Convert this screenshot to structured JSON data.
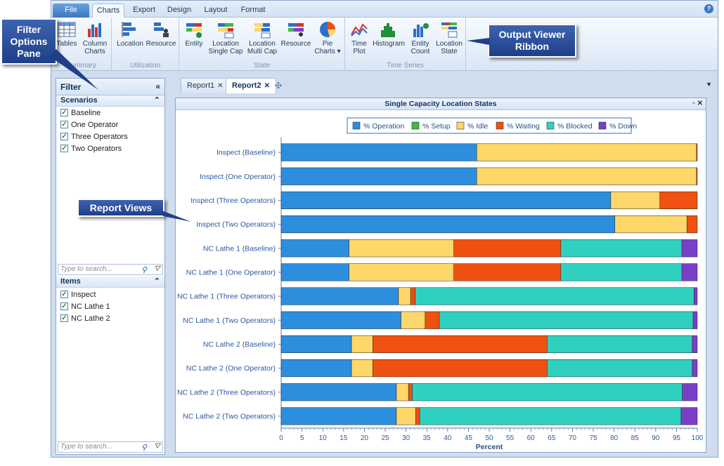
{
  "ribbon": {
    "tabs": [
      "File",
      "Charts",
      "Export",
      "Design",
      "Layout",
      "Format"
    ],
    "active_tab": "Charts",
    "groups": [
      {
        "label": "Summary",
        "buttons": [
          "Tables",
          "Column Charts"
        ]
      },
      {
        "label": "Utilization",
        "buttons": [
          "Location",
          "Resource"
        ]
      },
      {
        "label": "State",
        "buttons": [
          "Entity",
          "Location Single Cap",
          "Location Multi Cap",
          "Resource",
          "Pie Charts"
        ]
      },
      {
        "label": "Time Series",
        "buttons": [
          "Time Plot",
          "Histogram",
          "Entity Count",
          "Location State"
        ]
      }
    ]
  },
  "filter": {
    "title": "Filter",
    "scenarios_label": "Scenarios",
    "scenarios": [
      "Baseline",
      "One Operator",
      "Three Operators",
      "Two Operators"
    ],
    "items_label": "Items",
    "items": [
      "Inspect",
      "NC Lathe 1",
      "NC Lathe 2"
    ],
    "search_placeholder": "Type to search..."
  },
  "doc_tabs": [
    "Report1",
    "Report2"
  ],
  "active_doc_tab": "Report2",
  "callouts": {
    "filter_pane": "Filter Options Pane",
    "output_viewer": "Output Viewer Ribbon",
    "report_views": "Report Views"
  },
  "colors": {
    "operation": "#2e8ede",
    "setup": "#41b843",
    "idle": "#fdd76a",
    "waiting": "#f05010",
    "blocked": "#30d0c0",
    "down": "#7a3fc8"
  },
  "chart_data": {
    "type": "bar",
    "orientation": "horizontal",
    "stacked": true,
    "title": "Single Capacity Location States",
    "xlabel": "Percent",
    "ylabel": "",
    "xlim": [
      0,
      100
    ],
    "xticks": [
      0,
      5,
      10,
      15,
      20,
      25,
      30,
      35,
      40,
      45,
      50,
      55,
      60,
      65,
      70,
      75,
      80,
      85,
      90,
      95,
      100
    ],
    "legend_position": "top",
    "grid": false,
    "categories": [
      "Inspect (Baseline)",
      "Inspect (One Operator)",
      "Inspect (Three Operators)",
      "Inspect (Two Operators)",
      "NC Lathe 1 (Baseline)",
      "NC Lathe 1 (One Operator)",
      "NC Lathe 1 (Three Operators)",
      "NC Lathe 1 (Two Operators)",
      "NC Lathe 2 (Baseline)",
      "NC Lathe 2 (One Operator)",
      "NC Lathe 2 (Three Operators)",
      "NC Lathe 2 (Two Operators)"
    ],
    "series": [
      {
        "name": "% Operation",
        "color": "#2e8ede",
        "values": [
          47.0,
          47.0,
          79.2,
          80.2,
          16.3,
          16.3,
          28.2,
          28.8,
          16.9,
          16.9,
          27.7,
          27.7
        ]
      },
      {
        "name": "% Setup",
        "color": "#41b843",
        "values": [
          0,
          0,
          0,
          0,
          0,
          0,
          0,
          0,
          0,
          0,
          0,
          0
        ]
      },
      {
        "name": "% Idle",
        "color": "#fdd76a",
        "values": [
          52.8,
          52.8,
          11.8,
          17.3,
          25.2,
          25.2,
          2.9,
          5.8,
          5.1,
          5.1,
          2.9,
          4.6
        ]
      },
      {
        "name": "% Waiting",
        "color": "#f05010",
        "values": [
          0.2,
          0.2,
          9.0,
          2.5,
          25.7,
          25.7,
          1.1,
          3.4,
          41.9,
          41.9,
          0.9,
          1.0
        ]
      },
      {
        "name": "% Blocked",
        "color": "#30d0c0",
        "values": [
          0,
          0,
          0,
          0,
          29.1,
          29.1,
          67.0,
          61.0,
          34.9,
          34.9,
          64.9,
          62.8
        ]
      },
      {
        "name": "% Down",
        "color": "#7a3fc8",
        "values": [
          0,
          0,
          0,
          0,
          3.7,
          3.7,
          0.8,
          1.0,
          1.2,
          1.2,
          3.6,
          3.9
        ]
      }
    ]
  }
}
